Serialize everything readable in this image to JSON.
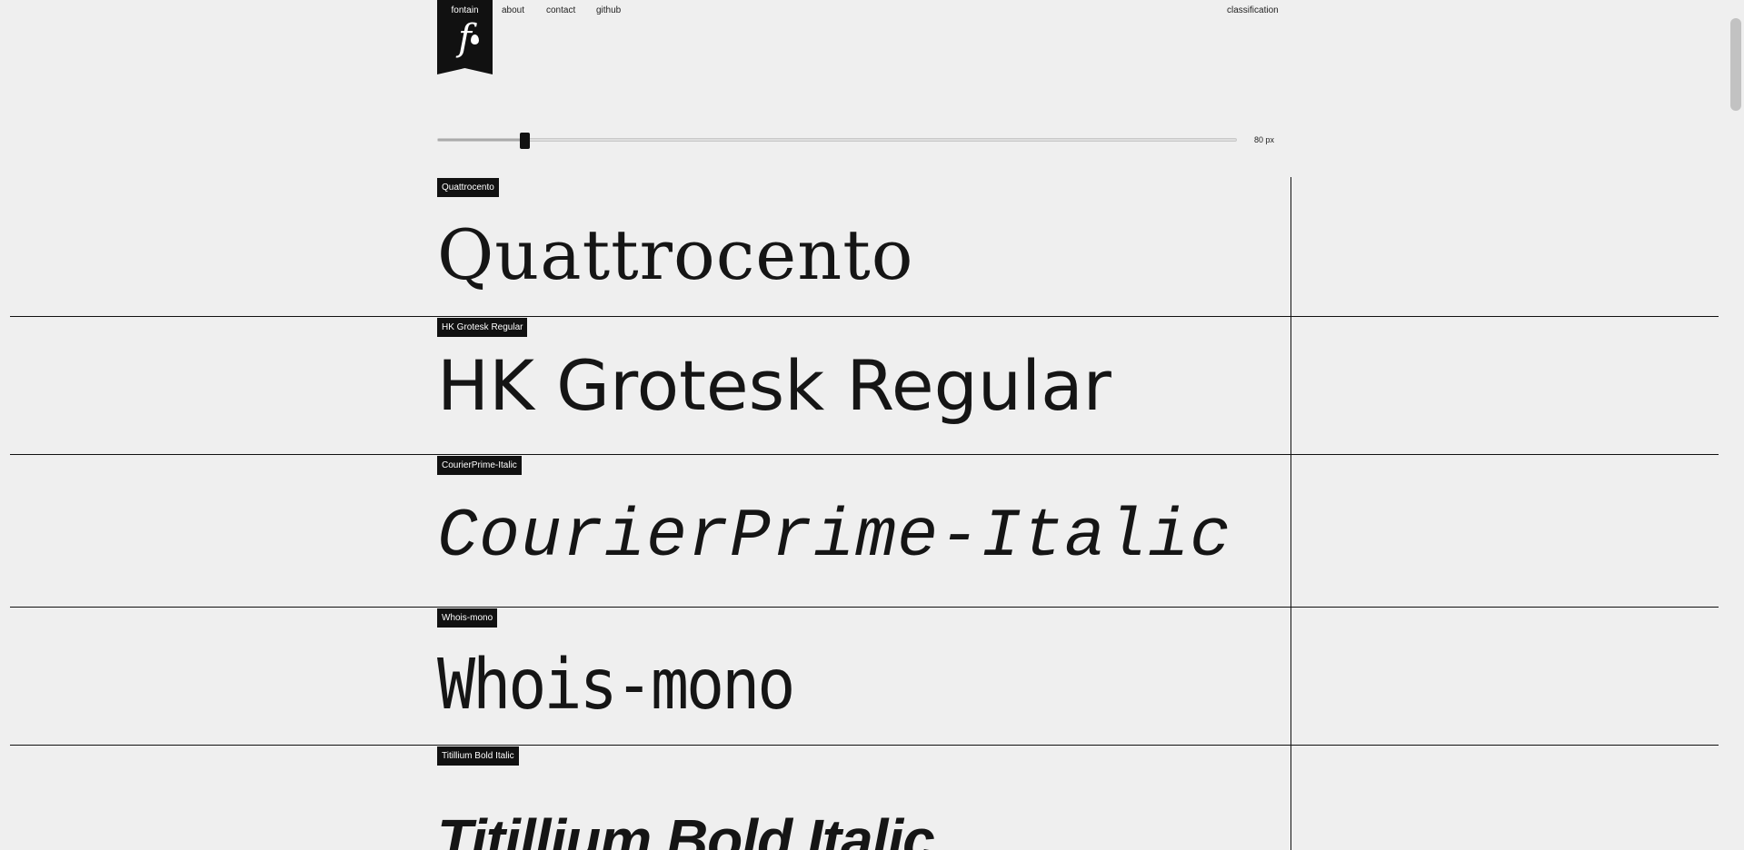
{
  "header": {
    "logo_text": "fontain",
    "logo_glyph": "f",
    "nav": {
      "about": "about",
      "contact": "contact",
      "github": "github",
      "classification": "classification"
    }
  },
  "size_slider": {
    "value": 80,
    "min": 0,
    "max": 700,
    "label": "80 px"
  },
  "fonts": [
    {
      "tag": "Quattrocento",
      "sample": "Quattrocento"
    },
    {
      "tag": "HK Grotesk Regular",
      "sample": "HK Grotesk Regular"
    },
    {
      "tag": "CourierPrime-Italic",
      "sample": "CourierPrime-Italic"
    },
    {
      "tag": "Whois-mono",
      "sample": "Whois-mono"
    },
    {
      "tag": "Titillium Bold Italic",
      "sample": "Titillium Bold Italic"
    }
  ],
  "colors": {
    "background": "#efefef",
    "ink": "#111111",
    "tag_text": "#ffffff"
  }
}
